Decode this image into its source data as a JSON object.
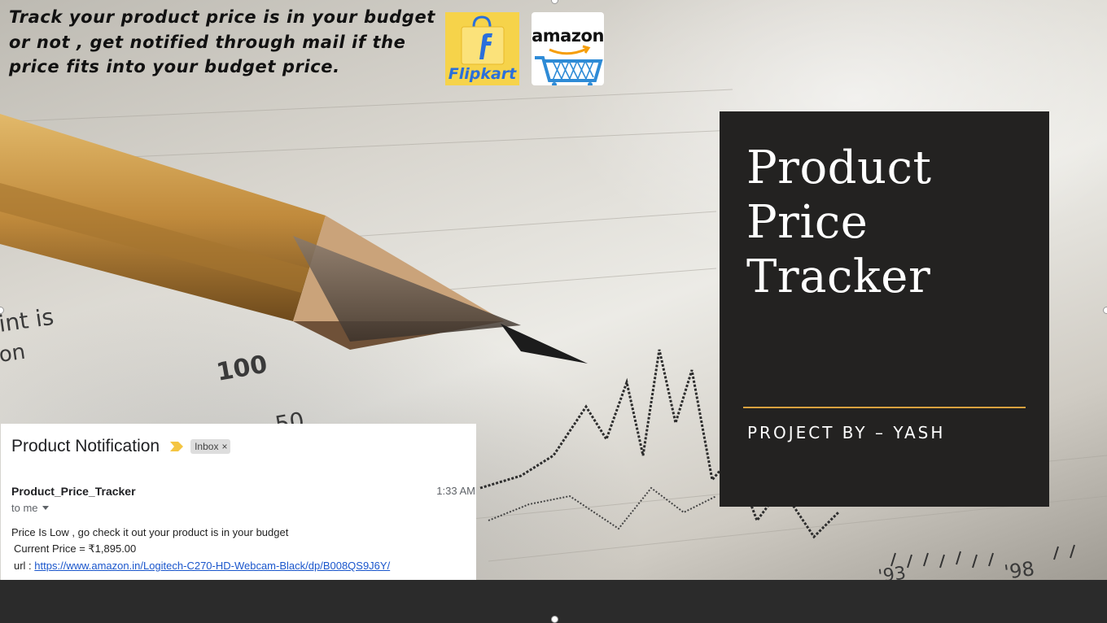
{
  "intro": {
    "text": "Track your product price is in your budget or not , get notified through mail if the price fits into your budget price."
  },
  "logos": {
    "flipkart": {
      "word": "Flipkart",
      "color": "#2a6fdb",
      "bg": "#f6d34a",
      "icon": "shopping-bag-icon"
    },
    "amazon": {
      "word": "amazon",
      "icon": "shopping-cart-icon",
      "accent": "#f59e0b",
      "cart_color": "#2e8bd6"
    }
  },
  "title_panel": {
    "lines": [
      "Product",
      "Price",
      "Tracker"
    ],
    "byline": "PROJECT BY – YASH",
    "accent": "#d9a13f",
    "bg": "#232221"
  },
  "email": {
    "subject": "Product Notification",
    "label": "Inbox",
    "label_close": "×",
    "sender": "Product_Price_Tracker",
    "time": "1:33 AM",
    "recipient": "to me",
    "body_line1": "Price Is Low , go check it out your product is in your budget",
    "price_line": "Current Price = ₹1,895.00",
    "url_label": "url : ",
    "url": "https://www.amazon.in/Logitech-C270-HD-Webcam-Black/dp/B008QS9J6Y/"
  },
  "background_graphic": {
    "numbers": [
      "100",
      "50",
      "int is",
      "on",
      "'93",
      "'98"
    ],
    "icon": "pencil-icon"
  }
}
